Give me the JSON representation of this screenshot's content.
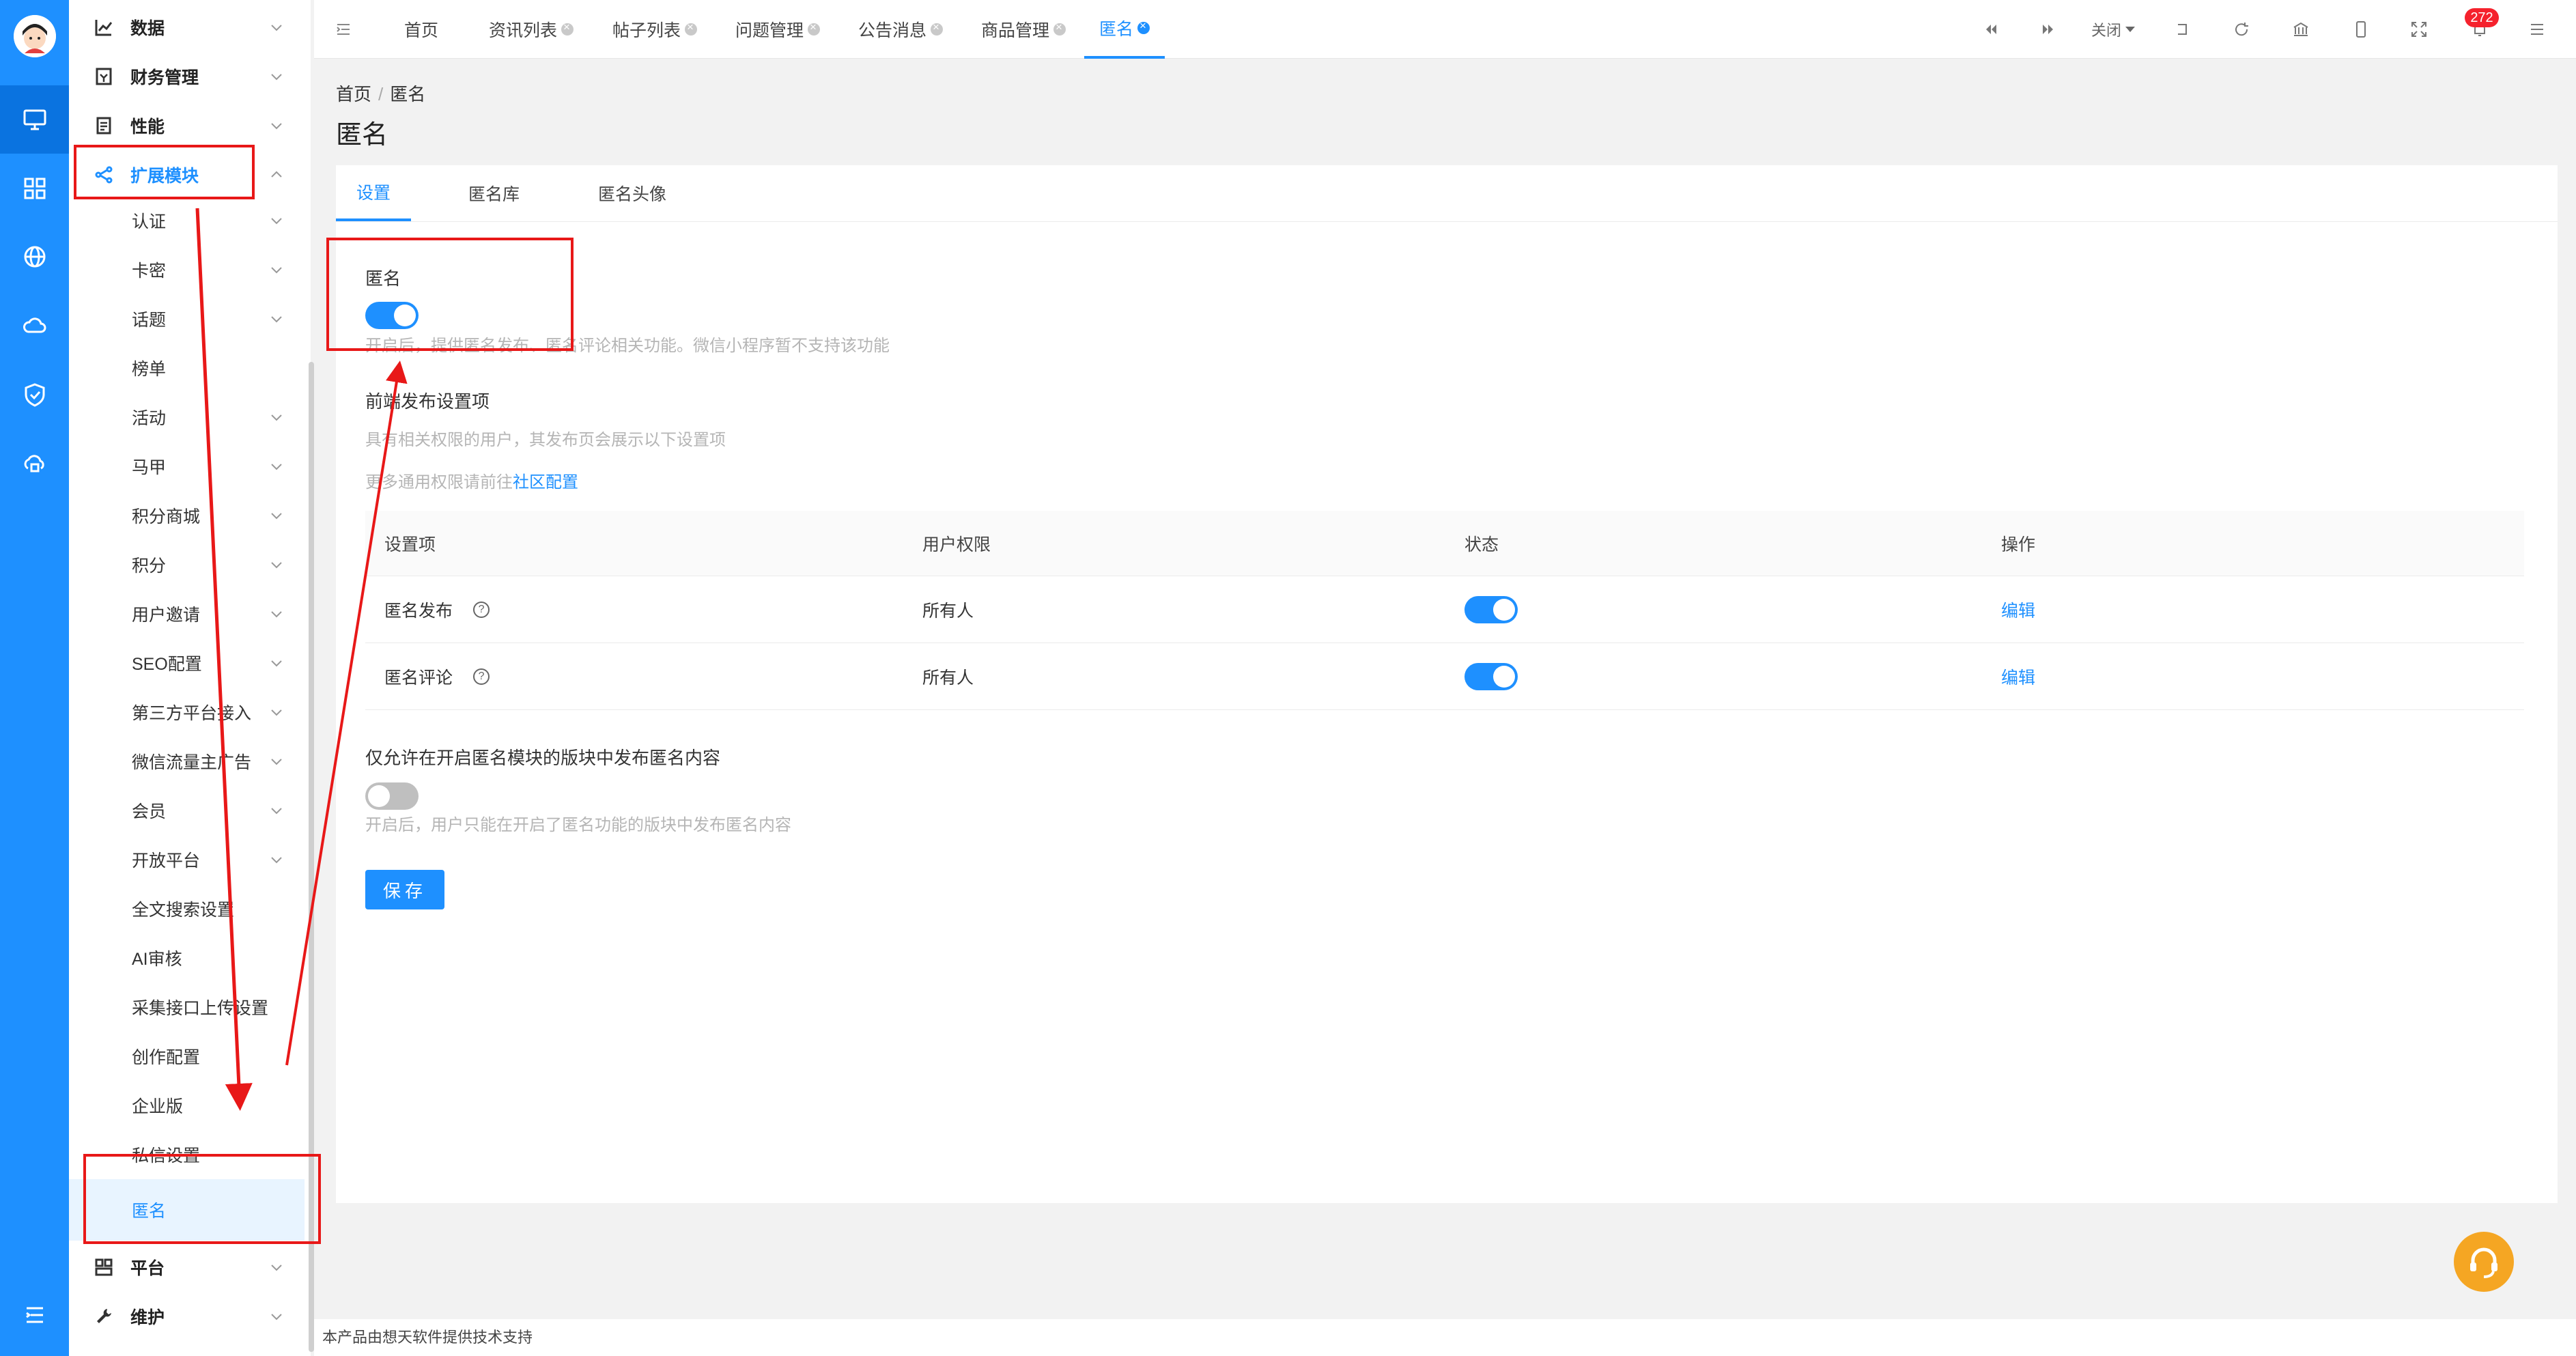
{
  "sidebar": {
    "items": [
      {
        "label": "数据",
        "icon": "chart-line-icon"
      },
      {
        "label": "财务管理",
        "icon": "finance-icon"
      },
      {
        "label": "性能",
        "icon": "performance-icon"
      },
      {
        "label": "扩展模块",
        "icon": "share-nodes-icon"
      },
      {
        "label": "认证"
      },
      {
        "label": "卡密"
      },
      {
        "label": "话题"
      },
      {
        "label": "榜单"
      },
      {
        "label": "活动"
      },
      {
        "label": "马甲"
      },
      {
        "label": "积分商城"
      },
      {
        "label": "积分"
      },
      {
        "label": "用户邀请"
      },
      {
        "label": "SEO配置"
      },
      {
        "label": "第三方平台接入"
      },
      {
        "label": "微信流量主广告"
      },
      {
        "label": "会员"
      },
      {
        "label": "开放平台"
      },
      {
        "label": "全文搜索设置"
      },
      {
        "label": "AI审核"
      },
      {
        "label": "采集接口上传设置"
      },
      {
        "label": "创作配置"
      },
      {
        "label": "企业版"
      },
      {
        "label": "私信设置"
      },
      {
        "label": "匿名"
      },
      {
        "label": "平台",
        "icon": "platform-icon"
      },
      {
        "label": "维护",
        "icon": "wrench-icon"
      }
    ]
  },
  "tabs": [
    {
      "label": "首页"
    },
    {
      "label": "资讯列表"
    },
    {
      "label": "帖子列表"
    },
    {
      "label": "问题管理"
    },
    {
      "label": "公告消息"
    },
    {
      "label": "商品管理"
    },
    {
      "label": "匿名"
    }
  ],
  "toolbar": {
    "close_label": "关闭",
    "notification_count": "272"
  },
  "breadcrumb": {
    "home": "首页",
    "separator": "/",
    "current": "匿名"
  },
  "page_title": "匿名",
  "panel_tabs": [
    {
      "label": "设置"
    },
    {
      "label": "匿名库"
    },
    {
      "label": "匿名头像"
    }
  ],
  "form": {
    "anon_label": "匿名",
    "anon_enabled": true,
    "anon_hint": "开启后，提供匿名发布、匿名评论相关功能。微信小程序暂不支持该功能",
    "frontend_label": "前端发布设置项",
    "frontend_hint": "具有相关权限的用户，其发布页会展示以下设置项",
    "more_hint_prefix": "更多通用权限请前往",
    "more_hint_link": "社区配置",
    "table_headers": [
      "设置项",
      "用户权限",
      "状态",
      "操作"
    ],
    "table_rows": [
      {
        "name": "匿名发布",
        "permission": "所有人",
        "enabled": true,
        "action": "编辑"
      },
      {
        "name": "匿名评论",
        "permission": "所有人",
        "enabled": true,
        "action": "编辑"
      }
    ],
    "restrict_label": "仅允许在开启匿名模块的版块中发布匿名内容",
    "restrict_enabled": false,
    "restrict_hint": "开启后，用户只能在开启了匿名功能的版块中发布匿名内容",
    "save_label": "保存"
  },
  "footer": "本产品由想天软件提供技术支持",
  "colors": {
    "primary": "#1e90ff",
    "annotation": "#e81818",
    "help_fab": "#f5a623"
  }
}
